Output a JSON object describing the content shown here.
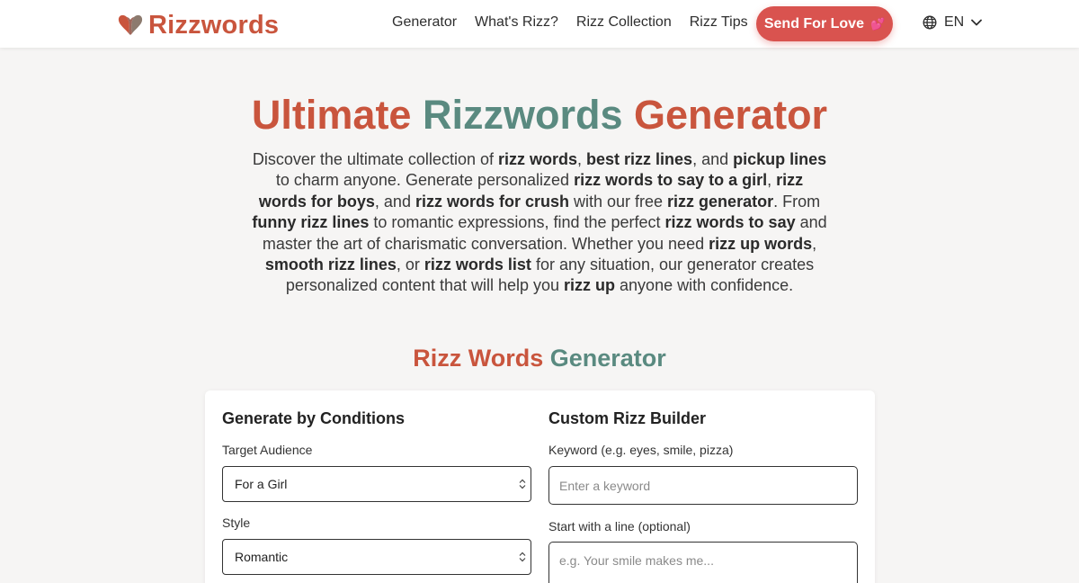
{
  "header": {
    "logo_text": "Rizzwords",
    "nav": [
      {
        "label": "Generator"
      },
      {
        "label": "What's Rizz?"
      },
      {
        "label": "Rizz Collection"
      },
      {
        "label": "Rizz Tips"
      }
    ],
    "cta_label": "Send For Love",
    "cta_emoji": "💕",
    "language": "EN"
  },
  "hero": {
    "title_part1": "Ultimate ",
    "title_part2": "Rizzwords",
    "title_part3": " Generator",
    "description": [
      {
        "t": "Discover the ultimate collection of "
      },
      {
        "t": "rizz words",
        "b": true
      },
      {
        "t": ", "
      },
      {
        "t": "best rizz lines",
        "b": true
      },
      {
        "t": ", and "
      },
      {
        "t": "pickup lines",
        "b": true
      },
      {
        "t": " to charm anyone. Generate personalized "
      },
      {
        "t": "rizz words to say to a girl",
        "b": true
      },
      {
        "t": ", "
      },
      {
        "t": "rizz words for boys",
        "b": true
      },
      {
        "t": ", and "
      },
      {
        "t": "rizz words for crush",
        "b": true
      },
      {
        "t": " with our free "
      },
      {
        "t": "rizz generator",
        "b": true
      },
      {
        "t": ". From "
      },
      {
        "t": "funny rizz lines",
        "b": true
      },
      {
        "t": " to romantic expressions, find the perfect "
      },
      {
        "t": "rizz words to say",
        "b": true
      },
      {
        "t": " and master the art of charismatic conversation. Whether you need "
      },
      {
        "t": "rizz up words",
        "b": true
      },
      {
        "t": ", "
      },
      {
        "t": "smooth rizz lines",
        "b": true
      },
      {
        "t": ", or "
      },
      {
        "t": "rizz words list",
        "b": true
      },
      {
        "t": " for any situation, our generator creates personalized content that will help you "
      },
      {
        "t": "rizz up",
        "b": true
      },
      {
        "t": " anyone with confidence."
      }
    ]
  },
  "generator": {
    "title_part1": "Rizz Words",
    "title_part2": " Generator",
    "conditions": {
      "heading": "Generate by Conditions",
      "audience_label": "Target Audience",
      "audience_value": "For a Girl",
      "style_label": "Style",
      "style_value": "Romantic"
    },
    "builder": {
      "heading": "Custom Rizz Builder",
      "keyword_label": "Keyword (e.g. eyes, smile, pizza)",
      "keyword_placeholder": "Enter a keyword",
      "start_label": "Start with a line (optional)",
      "start_placeholder": "e.g. Your smile makes me..."
    }
  },
  "colors": {
    "brand_red": "#c9553d",
    "brand_sage": "#5a8a80",
    "cta": "#d9534f",
    "background": "#f6f5f4"
  }
}
